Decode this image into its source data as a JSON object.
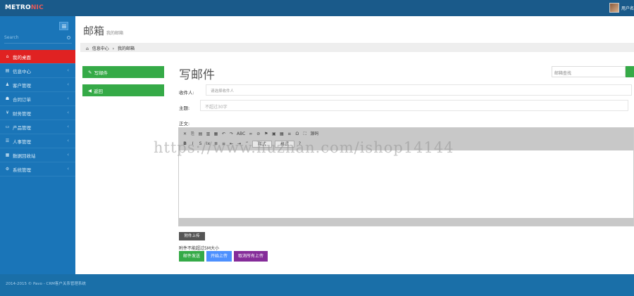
{
  "header": {
    "logo_main": "METRO",
    "logo_accent": "NIC",
    "user_name": "用户名"
  },
  "sidebar": {
    "search_placeholder": "Search",
    "items": [
      {
        "icon": "home-icon",
        "glyph": "⌂",
        "label": "我的桌面",
        "active": true
      },
      {
        "icon": "info-icon",
        "glyph": "▤",
        "label": "信息中心"
      },
      {
        "icon": "customer-icon",
        "glyph": "♟",
        "label": "客户管理"
      },
      {
        "icon": "order-icon",
        "glyph": "☗",
        "label": "合同订单"
      },
      {
        "icon": "finance-icon",
        "glyph": "¥",
        "label": "财务管理"
      },
      {
        "icon": "product-icon",
        "glyph": "▭",
        "label": "产品管理"
      },
      {
        "icon": "hr-icon",
        "glyph": "☰",
        "label": "人事管理"
      },
      {
        "icon": "data-icon",
        "glyph": "▦",
        "label": "数据回收站"
      },
      {
        "icon": "settings-icon",
        "glyph": "⚙",
        "label": "系统管理"
      }
    ]
  },
  "page": {
    "title": "邮箱",
    "subtitle": "我的邮箱",
    "breadcrumb": [
      "信息中心",
      "我的邮箱"
    ]
  },
  "mail_nav": {
    "compose_label": "写邮件",
    "back_label": "返回"
  },
  "compose": {
    "title": "写邮件",
    "search_placeholder": "邮箱查找",
    "to_label": "收件人:",
    "to_placeholder": "请选择收件人",
    "subject_label": "主题:",
    "subject_placeholder": "不超过30字",
    "body_label": "正文:",
    "toolbar_row1": [
      "✕",
      "⎘",
      "▤",
      "▥",
      "▦",
      "↶",
      "↷",
      "ABC",
      "∞",
      "⊘",
      "⚑",
      "▣",
      "▦",
      "≡",
      "Ω",
      "⛶",
      "源码"
    ],
    "toolbar_row2": [
      "B",
      "I",
      "S",
      "Ix",
      "≣",
      "≡",
      "⇤",
      "⇥",
      "”",
      "样式",
      "格式",
      "?"
    ],
    "attach_label": "附件上传",
    "attach_note": "附件不能超过5M大小",
    "send_label": "邮件发送",
    "start_label": "开始上传",
    "cancel_label": "取消所有上传"
  },
  "footer": {
    "text": "2014-2015 © Pavo - CRM客户关系管理系统"
  },
  "watermark": "https://www.huzhan.com/ishop14144",
  "colors": {
    "topbar": "#1a5a8a",
    "sidebar": "#1a75b8",
    "active": "#e02222",
    "green": "#35aa47",
    "blue": "#4d90fe",
    "purple": "#852b99"
  }
}
